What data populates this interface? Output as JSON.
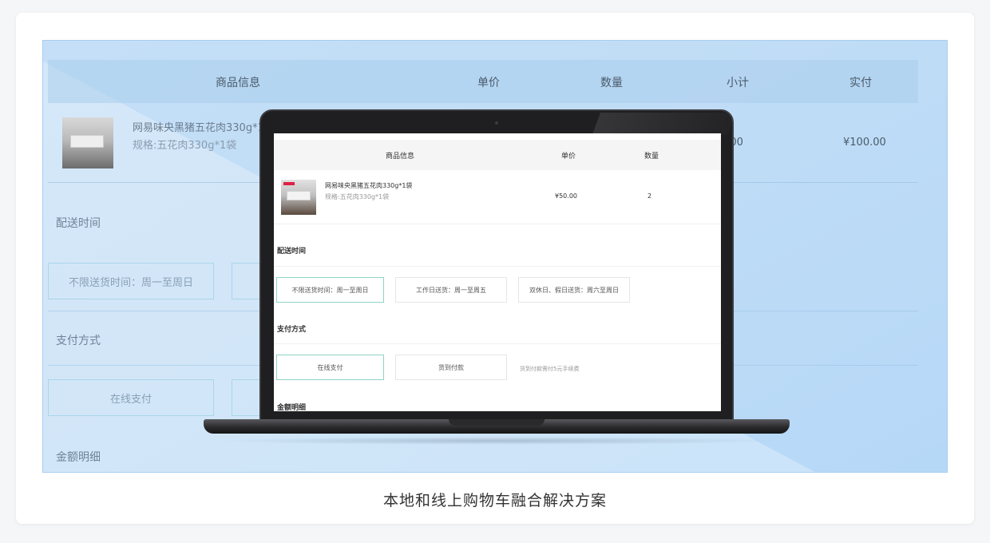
{
  "background_cart": {
    "headers": [
      "商品信息",
      "单价",
      "数量",
      "小计",
      "实付"
    ],
    "product_name": "网易味央黑猪五花肉330g*1袋",
    "product_spec": "规格:五花肉330g*1袋",
    "subtotal_partial": "0.00",
    "paid": "¥100.00",
    "delivery_title": "配送时间",
    "delivery_option_1": "不限送货时间：周一至周日",
    "payment_title": "支付方式",
    "payment_option_1": "在线支付",
    "amount_title": "金额明细"
  },
  "screen": {
    "headers": {
      "product": "商品信息",
      "price": "单价",
      "quantity": "数量"
    },
    "item": {
      "name": "网易味央黑猪五花肉330g*1袋",
      "spec": "规格:五花肉330g*1袋",
      "price": "¥50.00",
      "quantity": "2"
    },
    "delivery": {
      "title": "配送时间",
      "options": [
        "不限送货时间：周一至周日",
        "工作日送货：周一至周五",
        "双休日、假日送货：周六至周日"
      ]
    },
    "payment": {
      "title": "支付方式",
      "options": [
        "在线支付",
        "货到付款"
      ],
      "note": "货到付款需付5元手续费"
    },
    "amount_title": "金额明细"
  },
  "caption": "本地和线上购物车融合解决方案",
  "colors": {
    "stage_bg": "#c1ddf6",
    "active_border": "#8fd3c6",
    "laptop_body": "#1f1f22"
  }
}
